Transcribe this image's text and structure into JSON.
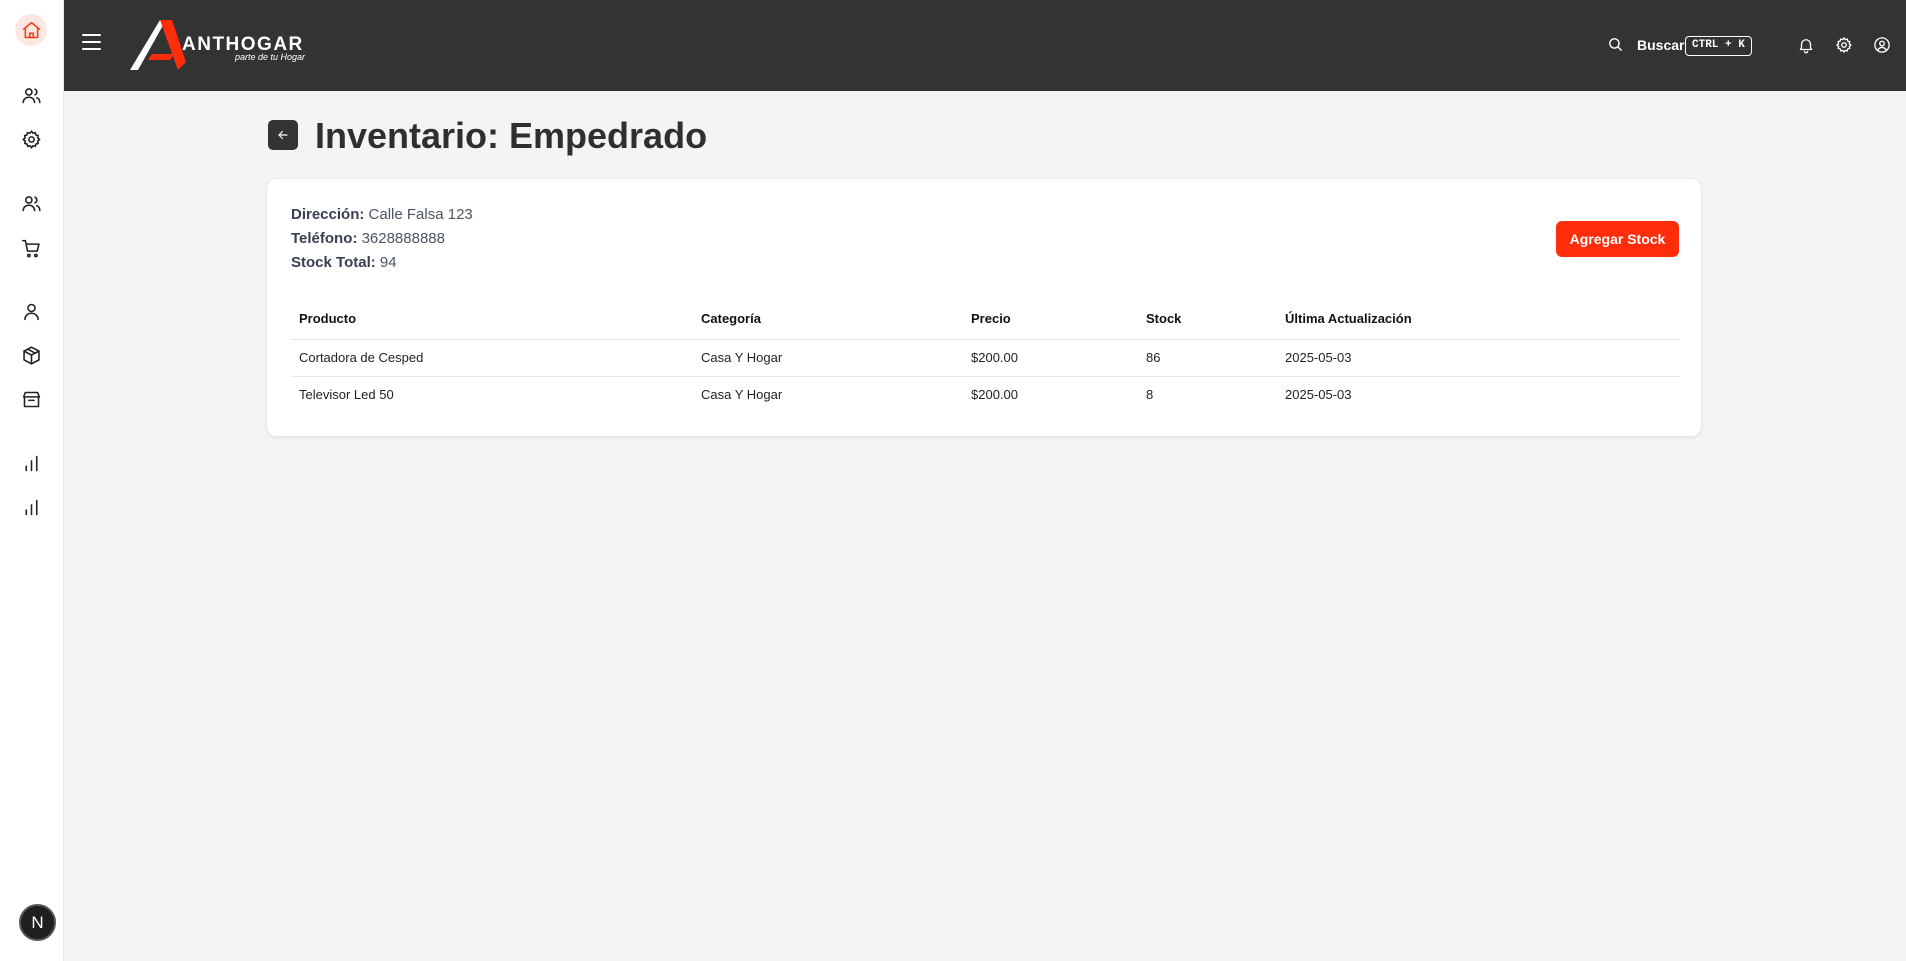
{
  "brand": {
    "name": "ANTHOGAR",
    "tagline": "parte de tu Hogar",
    "accent": "#ff2d0a",
    "header_bg": "#333333"
  },
  "header": {
    "search_label": "Buscar",
    "shortcut": "CTRL + K",
    "icons": [
      "search-icon",
      "bell-icon",
      "gear-icon",
      "user-circle-icon"
    ]
  },
  "sidebar": {
    "items": [
      "home-icon",
      "users-icon",
      "gear-icon",
      "users-icon",
      "cart-icon",
      "user-icon",
      "box-icon",
      "store-icon",
      "bar-chart-icon",
      "bar-chart-icon"
    ],
    "active": "home-icon",
    "footer_badge": "N"
  },
  "page": {
    "title": "Inventario: Empedrado"
  },
  "store": {
    "address_label": "Dirección:",
    "address": "Calle Falsa 123",
    "phone_label": "Teléfono:",
    "phone": "3628888888",
    "stock_label": "Stock Total:",
    "stock_total": "94",
    "add_button": "Agregar Stock"
  },
  "table": {
    "columns": [
      "Producto",
      "Categoría",
      "Precio",
      "Stock",
      "Última Actualización"
    ],
    "rows": [
      [
        "Cortadora de Cesped",
        "Casa Y Hogar",
        "$200.00",
        "86",
        "2025-05-03"
      ],
      [
        "Televisor Led 50",
        "Casa Y Hogar",
        "$200.00",
        "8",
        "2025-05-03"
      ]
    ]
  }
}
